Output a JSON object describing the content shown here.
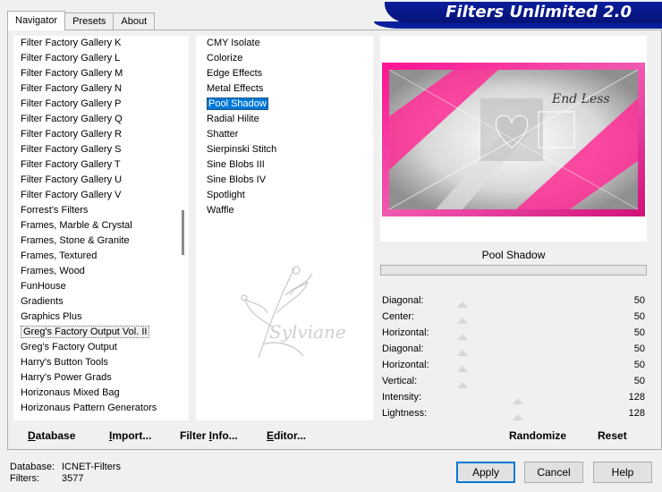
{
  "tabs": [
    {
      "label": "Navigator",
      "active": true
    },
    {
      "label": "Presets",
      "active": false
    },
    {
      "label": "About",
      "active": false
    }
  ],
  "app_title": "Filters Unlimited 2.0",
  "categories": [
    "Filter Factory Gallery K",
    "Filter Factory Gallery L",
    "Filter Factory Gallery M",
    "Filter Factory Gallery N",
    "Filter Factory Gallery P",
    "Filter Factory Gallery Q",
    "Filter Factory Gallery R",
    "Filter Factory Gallery S",
    "Filter Factory Gallery T",
    "Filter Factory Gallery U",
    "Filter Factory Gallery V",
    "Forrest's Filters",
    "Frames, Marble & Crystal",
    "Frames, Stone & Granite",
    "Frames, Textured",
    "Frames, Wood",
    "FunHouse",
    "Gradients",
    "Graphics Plus",
    "Greg's Factory Output Vol. II",
    "Greg's Factory Output",
    "Harry's Button Tools",
    "Harry's Power Grads",
    "Horizonaus Mixed Bag",
    "Horizonaus Pattern Generators"
  ],
  "selected_category": "Greg's Factory Output Vol. II",
  "filters": [
    "CMY Isolate",
    "Colorize",
    "Edge Effects",
    "Metal Effects",
    "Pool Shadow",
    "Radial Hilite",
    "Shatter",
    "Sierpinski Stitch",
    "Sine Blobs III",
    "Sine Blobs IV",
    "Spotlight",
    "Waffle"
  ],
  "selected_filter": "Pool Shadow",
  "preview": {
    "filter_name": "Pool Shadow",
    "colors": {
      "pink": "#ff1493",
      "gray": "#b0b0b0",
      "white": "#ffffff"
    }
  },
  "sliders": [
    {
      "label": "Diagonal:",
      "value": "50",
      "fraction": 0.2
    },
    {
      "label": "Center:",
      "value": "50",
      "fraction": 0.2
    },
    {
      "label": "Horizontal:",
      "value": "50",
      "fraction": 0.2
    },
    {
      "label": "Diagonal:",
      "value": "50",
      "fraction": 0.2
    },
    {
      "label": "Horizontal:",
      "value": "50",
      "fraction": 0.2
    },
    {
      "label": "Vertical:",
      "value": "50",
      "fraction": 0.2
    },
    {
      "label": "Intensity:",
      "value": "128",
      "fraction": 0.5
    },
    {
      "label": "Lightness:",
      "value": "128",
      "fraction": 0.5
    }
  ],
  "panel_buttons": {
    "database": {
      "first": "D",
      "rest": "atabase"
    },
    "import": {
      "first": "I",
      "rest": "mport..."
    },
    "filter_info": {
      "first": "Filter ",
      "ul": "I",
      "rest": "nfo..."
    },
    "editor": {
      "first": "E",
      "rest": "ditor..."
    },
    "randomize": "Randomize",
    "reset": "Reset"
  },
  "status": {
    "database_label": "Database:",
    "database_value": "ICNET-Filters",
    "filters_label": "Filters:",
    "filters_value": "3577"
  },
  "dialog_buttons": {
    "apply": "Apply",
    "cancel": "Cancel",
    "help": "Help"
  }
}
